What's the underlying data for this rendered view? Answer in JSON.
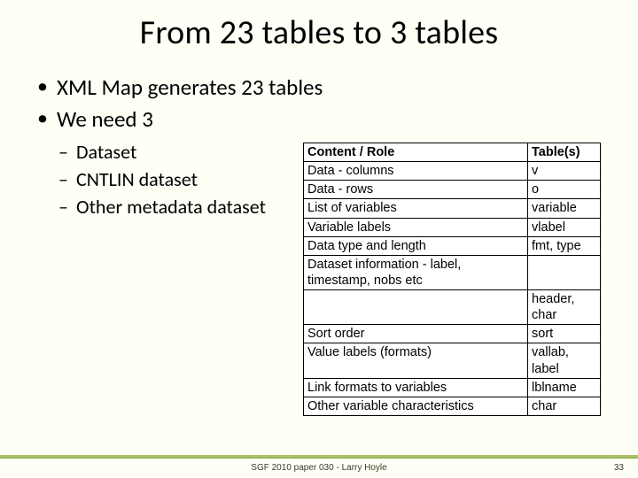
{
  "title": "From 23 tables to 3 tables",
  "bullets": [
    "XML Map generates 23 tables",
    "We need 3"
  ],
  "subbullets": [
    "Dataset",
    "CNTLIN dataset",
    "Other metadata dataset"
  ],
  "table": {
    "headers": [
      "Content / Role",
      "Table(s)"
    ],
    "rows": [
      [
        "Data - columns",
        "v"
      ],
      [
        "Data - rows",
        "o"
      ],
      [
        "List of variables",
        "variable"
      ],
      [
        "Variable labels",
        "vlabel"
      ],
      [
        "Data type and length",
        "fmt,  type"
      ],
      [
        "Dataset information - label, timestamp, nobs etc",
        ""
      ],
      [
        "",
        "header, char"
      ],
      [
        "Sort order",
        "sort"
      ],
      [
        "Value labels (formats)",
        "vallab, label"
      ],
      [
        "Link formats to variables",
        "lblname"
      ],
      [
        "Other variable characteristics",
        "char"
      ]
    ]
  },
  "footer": "SGF 2010 paper 030  - Larry Hoyle",
  "page": "33",
  "chart_data": {
    "type": "table",
    "title": "From 23 tables to 3 tables",
    "columns": [
      "Content / Role",
      "Table(s)"
    ],
    "rows": [
      {
        "content_role": "Data - columns",
        "tables": "v"
      },
      {
        "content_role": "Data - rows",
        "tables": "o"
      },
      {
        "content_role": "List of variables",
        "tables": "variable"
      },
      {
        "content_role": "Variable labels",
        "tables": "vlabel"
      },
      {
        "content_role": "Data type and length",
        "tables": "fmt, type"
      },
      {
        "content_role": "Dataset information - label, timestamp, nobs etc",
        "tables": "header, char"
      },
      {
        "content_role": "Sort order",
        "tables": "sort"
      },
      {
        "content_role": "Value labels (formats)",
        "tables": "vallab, label"
      },
      {
        "content_role": "Link formats to variables",
        "tables": "lblname"
      },
      {
        "content_role": "Other variable characteristics",
        "tables": "char"
      }
    ]
  }
}
